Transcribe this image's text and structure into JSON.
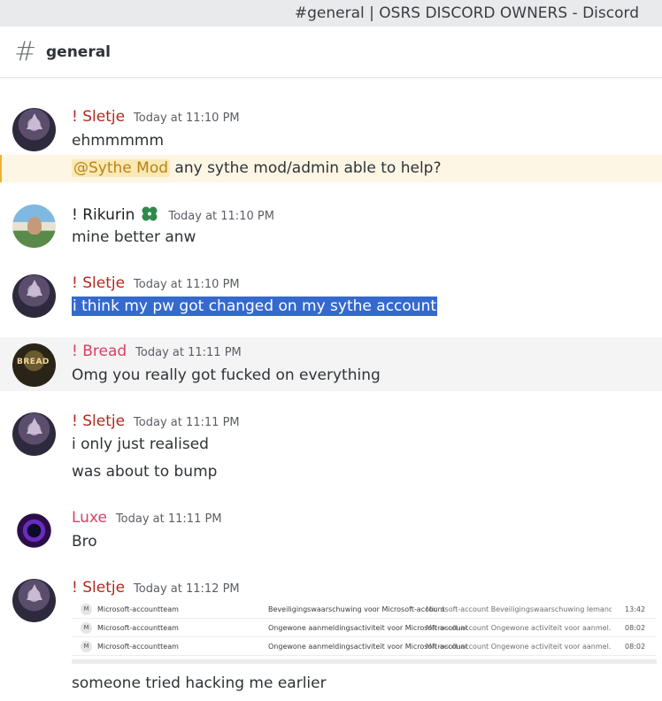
{
  "window": {
    "title": "#general | OSRS DISCORD OWNERS - Discord"
  },
  "channel": {
    "hash_icon": "#",
    "name": "general"
  },
  "colors": {
    "sletje": "#b1281e",
    "rikurin": "#1b1f24",
    "bread": "#d93f63",
    "luxe": "#d93f63",
    "mention_bg": "#fbe9b5",
    "mention_text": "#b98314",
    "selection": "#3569ce"
  },
  "messages": {
    "m1": {
      "author": "! Sletje",
      "time": "Today at 11:10 PM",
      "lines": [
        "ehmmmmm"
      ],
      "mention": "@Sythe Mod",
      "mention_rest": " any sythe mod/admin able to help?"
    },
    "m2": {
      "author": "! Rikurin",
      "time": "Today at 11:10 PM",
      "badge_icon": "clover-icon",
      "lines": [
        "mine better anw"
      ]
    },
    "m3": {
      "author": "! Sletje",
      "time": "Today at 11:10 PM",
      "lines": [
        "i think my pw got changed on my sythe account"
      ]
    },
    "m4": {
      "author": "! Bread",
      "time": "Today at 11:11 PM",
      "lines": [
        "Omg you really got fucked on everything"
      ]
    },
    "m5": {
      "author": "! Sletje",
      "time": "Today at 11:11 PM",
      "lines": [
        "i only just realised",
        "was about to bump"
      ]
    },
    "m6": {
      "author": "Luxe",
      "time": "Today at 11:11 PM",
      "lines": [
        "Bro"
      ]
    },
    "m7": {
      "author": "! Sletje",
      "time": "Today at 11:12 PM",
      "attachment": {
        "rows": [
          {
            "icon": "M",
            "sender": "Microsoft-accountteam",
            "subject": "Beveiligingswaarschuwing voor Microsoft-account",
            "preview": "Microsoft-account Beveiligingswaarschuwing Iemand ander...",
            "time": "13:42"
          },
          {
            "icon": "M",
            "sender": "Microsoft-accountteam",
            "subject": "Ongewone aanmeldingsactiviteit voor Microsoft-account",
            "preview": "Microsoft-account Ongewone activiteit voor aanmel...",
            "time": "08:02"
          },
          {
            "icon": "M",
            "sender": "Microsoft-accountteam",
            "subject": "Ongewone aanmeldingsactiviteit voor Microsoft-account",
            "preview": "Microsoft-account Ongewone activiteit voor aanmel...",
            "time": "08:02"
          }
        ]
      },
      "lines": [
        "someone tried hacking me earlier"
      ]
    }
  }
}
